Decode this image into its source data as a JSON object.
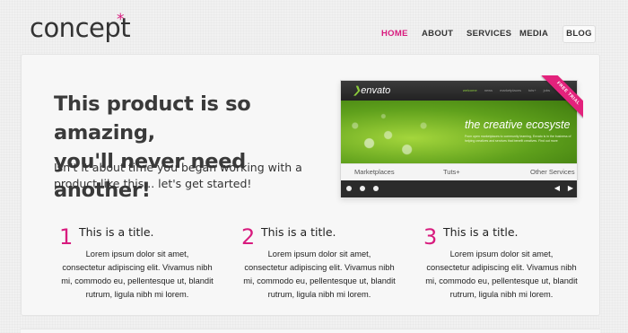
{
  "brand": {
    "name": "concept",
    "star": "*",
    "accent_color": "#d81b7e"
  },
  "nav": {
    "items": [
      {
        "label": "HOME",
        "active": true
      },
      {
        "label": "ABOUT",
        "active": false
      },
      {
        "label": "SERVICES",
        "active": false
      },
      {
        "label": "MEDIA",
        "active": false
      },
      {
        "label": "BLOG",
        "active": false
      }
    ]
  },
  "hero": {
    "title_line1": "This product is so amazing,",
    "title_line2": "you'll never need another!",
    "subtitle_line1": "Isn't it about time you began working with a",
    "subtitle_line2": "product like this... let's get started!"
  },
  "showcase": {
    "logo": "envato",
    "top_menu": [
      "welcome",
      "news",
      "marketplaces",
      "tuts+",
      "jobs"
    ],
    "banner_title": "the creative ecosyste",
    "banner_text": "From open marketplaces to community learning, Envato is in the business of helping creatives and services that benefit creatives. Find out more",
    "ribbon": "FREE TRIAL",
    "tabs": [
      "Marketplaces",
      "Tuts+",
      "Other Services"
    ],
    "prev_arrow": "◀",
    "next_arrow": "▶",
    "banner_color": "#5fa01c",
    "ribbon_color": "#e3227c"
  },
  "features": [
    {
      "number": "1",
      "title": "This is a title.",
      "line1": "Lorem ipsum dolor sit amet,",
      "line2": "consectetur adipiscing elit. Vivamus nibh",
      "line3": "mi, commodo eu, pellentesque ut, blandit",
      "line4": "rutrum, ligula nibh mi lorem."
    },
    {
      "number": "2",
      "title": "This is a title.",
      "line1": "Lorem ipsum dolor sit amet,",
      "line2": "consectetur adipiscing elit. Vivamus nibh",
      "line3": "mi, commodo eu, pellentesque ut, blandit",
      "line4": "rutrum, ligula nibh mi lorem."
    },
    {
      "number": "3",
      "title": "This is a title.",
      "line1": "Lorem ipsum dolor sit amet,",
      "line2": "consectetur adipiscing elit. Vivamus nibh",
      "line3": "mi, commodo eu, pellentesque ut, blandit",
      "line4": "rutrum, ligula nibh mi lorem."
    }
  ]
}
